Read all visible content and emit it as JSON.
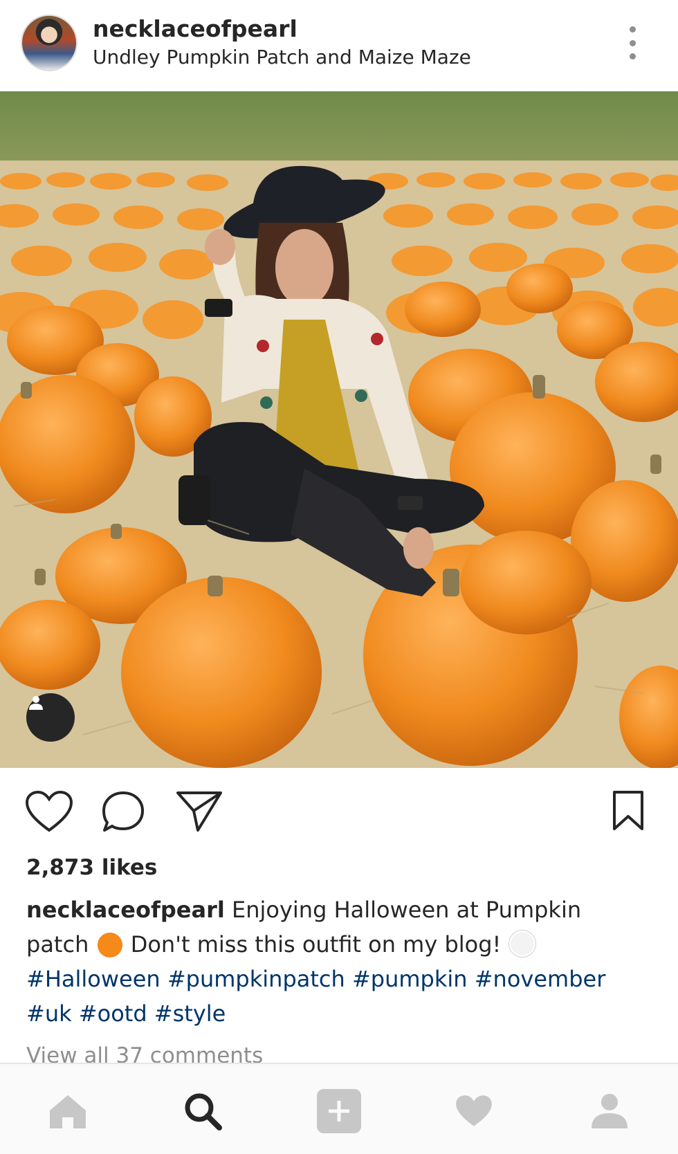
{
  "post": {
    "username": "necklaceofpearl",
    "location": "Undley Pumpkin Patch and Maize Maze",
    "likes": "2,873 likes",
    "caption": {
      "username": "necklaceofpearl",
      "text_1": "Enjoying Halloween at Pumpkin patch",
      "emoji_1": "pumpkin-emoji",
      "text_2": "Don't miss this outfit on my blog!",
      "emoji_2": "ghost-emoji",
      "hashtags": [
        "#Halloween",
        "#pumpkinpatch",
        "#pumpkin",
        "#november",
        "#uk",
        "#ootd",
        "#style"
      ]
    },
    "view_comments": "View all 37 comments"
  },
  "icons": {
    "more": "more-options-icon",
    "tag": "user-tag-icon",
    "like": "heart-icon",
    "comment": "comment-icon",
    "share": "send-icon",
    "save": "bookmark-icon"
  },
  "bottom_nav": [
    "home-icon",
    "search-icon",
    "add-icon",
    "activity-heart-icon",
    "profile-icon"
  ],
  "colors": {
    "hashtag": "#003569",
    "text": "#262626",
    "muted": "#8e8e8e",
    "nav_inactive": "#c7c7c7"
  }
}
